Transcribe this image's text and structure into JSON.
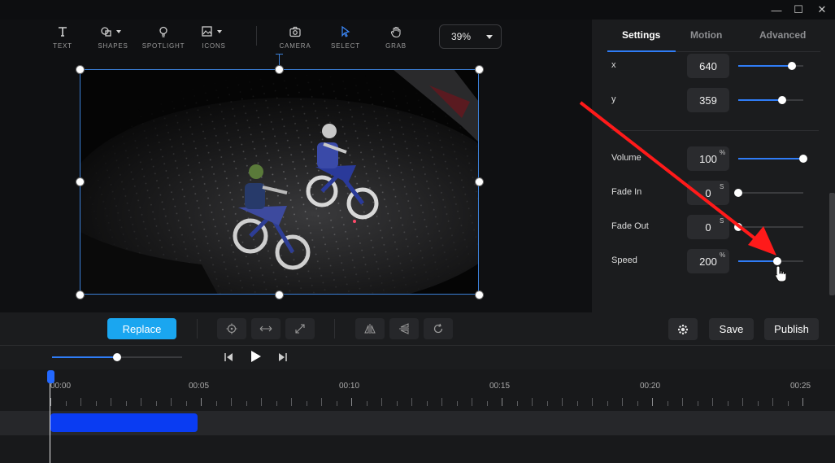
{
  "window": {
    "minimize_glyph": "—",
    "maximize_glyph": "☐",
    "close_glyph": "✕"
  },
  "toolbar": {
    "tools": [
      {
        "label": "TEXT",
        "icon": "text-icon"
      },
      {
        "label": "SHAPES",
        "icon": "shapes-icon"
      },
      {
        "label": "SPOTLIGHT",
        "icon": "spotlight-icon"
      },
      {
        "label": "ICONS",
        "icon": "icons-icon"
      },
      {
        "label": "CAMERA",
        "icon": "camera-icon"
      },
      {
        "label": "SELECT",
        "icon": "cursor-icon",
        "active": true
      },
      {
        "label": "GRAB",
        "icon": "hand-icon"
      }
    ],
    "zoom_value": "39%"
  },
  "panel": {
    "tabs": [
      "Settings",
      "Motion",
      "Advanced"
    ],
    "active_tab": "Settings",
    "properties": [
      {
        "label": "x",
        "value": "640",
        "unit": "",
        "fraction": 0.82
      },
      {
        "label": "y",
        "value": "359",
        "unit": "",
        "fraction": 0.68
      },
      {
        "label": "Volume",
        "value": "100",
        "unit": "%",
        "fraction": 1.0
      },
      {
        "label": "Fade In",
        "value": "0",
        "unit": "S",
        "fraction": 0.0
      },
      {
        "label": "Fade Out",
        "value": "0",
        "unit": "S",
        "fraction": 0.0
      },
      {
        "label": "Speed",
        "value": "200",
        "unit": "%",
        "fraction": 0.6
      }
    ]
  },
  "actions": {
    "replace_label": "Replace",
    "save_label": "Save",
    "publish_label": "Publish"
  },
  "playback": {
    "volume_fraction": 0.5
  },
  "timeline": {
    "ruler_labels": [
      "00:00",
      "00:05",
      "00:10",
      "00:15",
      "00:20",
      "00:25"
    ]
  },
  "colors": {
    "accent": "#2f7cf6",
    "replace": "#1aa6f0",
    "clip": "#0a3cf2",
    "annotation_arrow": "#ff1a1a"
  }
}
